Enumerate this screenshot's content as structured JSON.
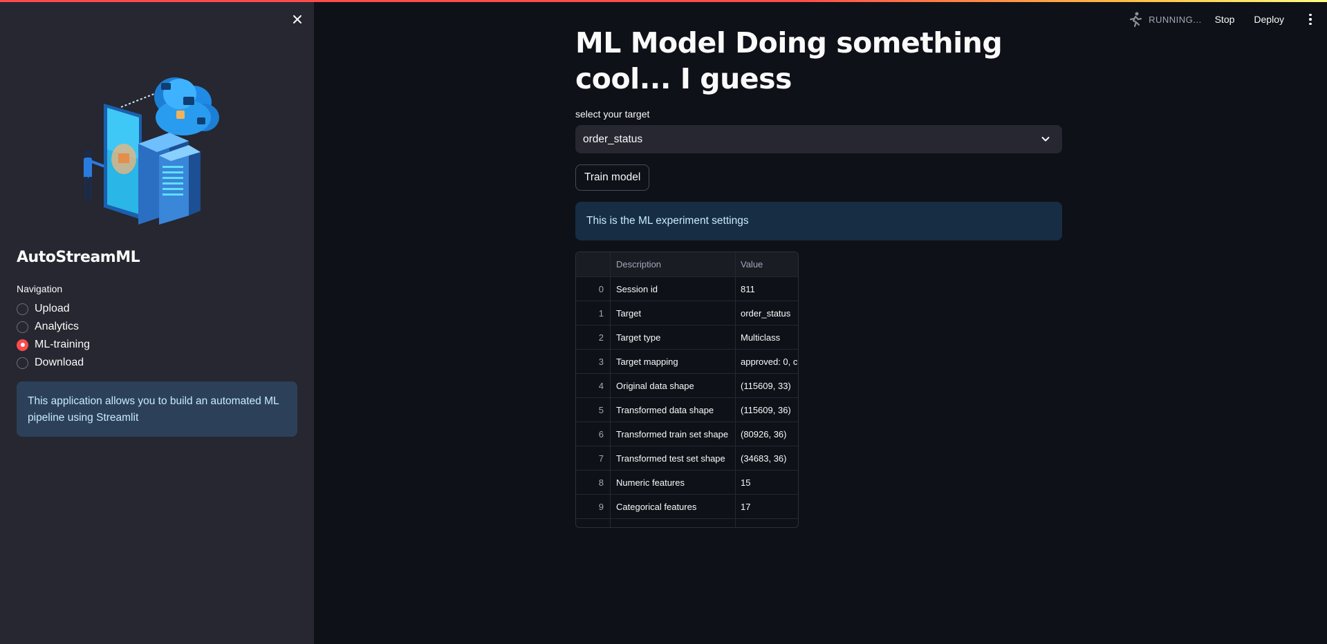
{
  "sidebar": {
    "app_title": "AutoStreamML",
    "nav_label": "Navigation",
    "nav_items": [
      {
        "label": "Upload",
        "selected": false
      },
      {
        "label": "Analytics",
        "selected": false
      },
      {
        "label": "ML-training",
        "selected": true
      },
      {
        "label": "Download",
        "selected": false
      }
    ],
    "info_text": "This application allows you to build an automated ML pipeline using Streamlit"
  },
  "header": {
    "status": "RUNNING...",
    "stop_label": "Stop",
    "deploy_label": "Deploy"
  },
  "main": {
    "title": "ML Model Doing something cool... I guess",
    "select_label": "select your target",
    "select_value": "order_status",
    "train_button": "Train model",
    "info_text": "This is the ML experiment settings",
    "table": {
      "columns": [
        "",
        "Description",
        "Value"
      ],
      "rows": [
        {
          "index": "0",
          "description": "Session id",
          "value": "811"
        },
        {
          "index": "1",
          "description": "Target",
          "value": "order_status"
        },
        {
          "index": "2",
          "description": "Target type",
          "value": "Multiclass"
        },
        {
          "index": "3",
          "description": "Target mapping",
          "value": "approved: 0, c"
        },
        {
          "index": "4",
          "description": "Original data shape",
          "value": "(115609, 33)"
        },
        {
          "index": "5",
          "description": "Transformed data shape",
          "value": "(115609, 36)"
        },
        {
          "index": "6",
          "description": "Transformed train set shape",
          "value": "(80926, 36)"
        },
        {
          "index": "7",
          "description": "Transformed test set shape",
          "value": "(34683, 36)"
        },
        {
          "index": "8",
          "description": "Numeric features",
          "value": "15"
        },
        {
          "index": "9",
          "description": "Categorical features",
          "value": "17"
        }
      ]
    }
  },
  "colors": {
    "accent": "#ff4b4b",
    "background": "#0e1117",
    "sidebar": "#262730",
    "info_bg": "#172d43",
    "info_text": "#c7ebff"
  }
}
